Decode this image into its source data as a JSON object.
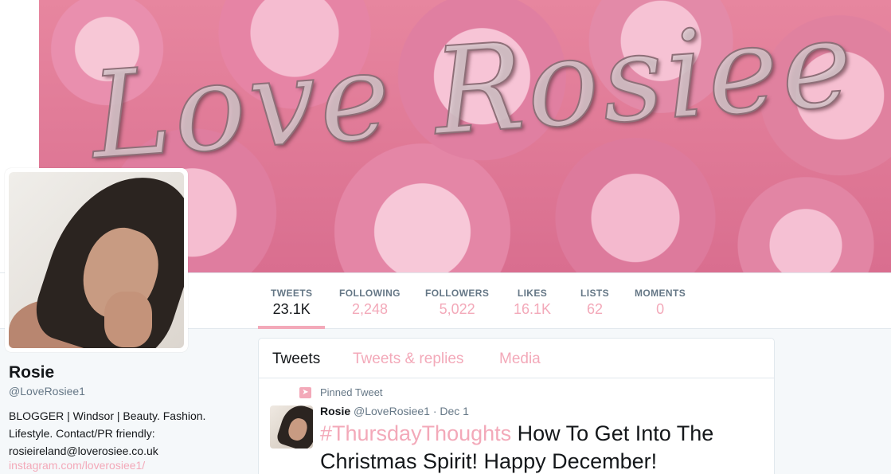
{
  "banner": {
    "title": "Love Rosiee"
  },
  "colors": {
    "accent": "#f3a9b9",
    "text": "#14171a",
    "muted": "#657786",
    "border": "#e1e8ed"
  },
  "profile": {
    "name": "Rosie",
    "handle": "@LoveRosiee1",
    "bio_line1": "BLOGGER | Windsor | Beauty. Fashion.",
    "bio_line2": "Lifestyle. Contact/PR friendly:",
    "bio_line3": "rosieireland@loverosiee.co.uk",
    "link": "instagram.com/loverosiee1/"
  },
  "nav": {
    "stats": [
      {
        "label": "TWEETS",
        "value": "23.1K"
      },
      {
        "label": "FOLLOWING",
        "value": "2,248"
      },
      {
        "label": "FOLLOWERS",
        "value": "5,022"
      },
      {
        "label": "LIKES",
        "value": "16.1K"
      },
      {
        "label": "LISTS",
        "value": "62"
      },
      {
        "label": "MOMENTS",
        "value": "0"
      }
    ]
  },
  "timeline": {
    "tabs": [
      "Tweets",
      "Tweets & replies",
      "Media"
    ],
    "pinned_label": "Pinned Tweet",
    "pin_icon": "pin-icon",
    "tweet": {
      "name": "Rosie",
      "handle": "@LoveRosiee1",
      "date": "· Dec 1",
      "hashtag": "#ThursdayThoughts",
      "text": " How To Get Into The Christmas Spirit! Happy December!"
    }
  }
}
